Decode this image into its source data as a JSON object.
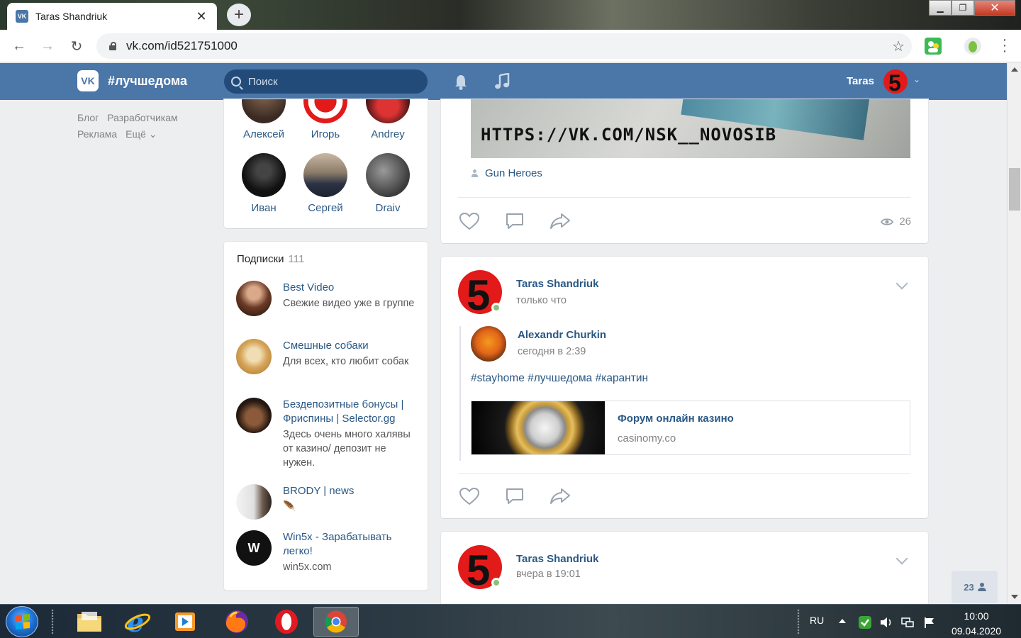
{
  "browser": {
    "tab_title": "Taras Shandriuk",
    "tab_favicon": "VK",
    "new_tab_label": "+",
    "url": "vk.com/id521751000",
    "win_minimize": "▁",
    "win_maximize": "❐",
    "win_close": "✕"
  },
  "vk_header": {
    "logo": "VK",
    "brand": "#лучшедома",
    "search_placeholder": "Поиск",
    "user_name": "Taras",
    "brand_color": "#4a76a8"
  },
  "footer_links": {
    "blog": "Блог",
    "developers": "Разработчикам",
    "ads": "Реклама",
    "more": "Ещё ⌄"
  },
  "friends": [
    {
      "name": "Алексей"
    },
    {
      "name": "Игорь"
    },
    {
      "name": "Andrey"
    },
    {
      "name": "Иван"
    },
    {
      "name": "Сергей"
    },
    {
      "name": "Draiv"
    }
  ],
  "subscriptions": {
    "title": "Подписки",
    "count": "111",
    "items": [
      {
        "title": "Best Video",
        "desc": "Свежие видео уже в группе"
      },
      {
        "title": "Смешные собаки",
        "desc": "Для всех, кто любит собак"
      },
      {
        "title": "Бездепозитные бонусы | Фриспины | Selector.gg",
        "desc": "Здесь очень много халявы от казино/ депозит не нужен."
      },
      {
        "title": "BRODY | news",
        "desc": "🪶"
      },
      {
        "title": "Win5x - Зарабатывать легко!",
        "desc": "win5x.com"
      }
    ]
  },
  "post1": {
    "image_text": "HTTPS://VK.COM/NSK__NOVOSIB",
    "source": "Gun Heroes",
    "views": "26"
  },
  "post2": {
    "author": "Taras Shandriuk",
    "time": "только что",
    "repost_author": "Alexandr Churkin",
    "repost_time": "сегодня в 2:39",
    "hashtags": "#stayhome #лучшедома #карантин",
    "link_title": "Форум онлайн казино",
    "link_domain": "casinomy.co"
  },
  "post3": {
    "author": "Taras Shandriuk",
    "time": "вчера в 19:01"
  },
  "online_counter": "23",
  "taskbar": {
    "lang": "RU",
    "time": "10:00",
    "date": "09.04.2020"
  }
}
